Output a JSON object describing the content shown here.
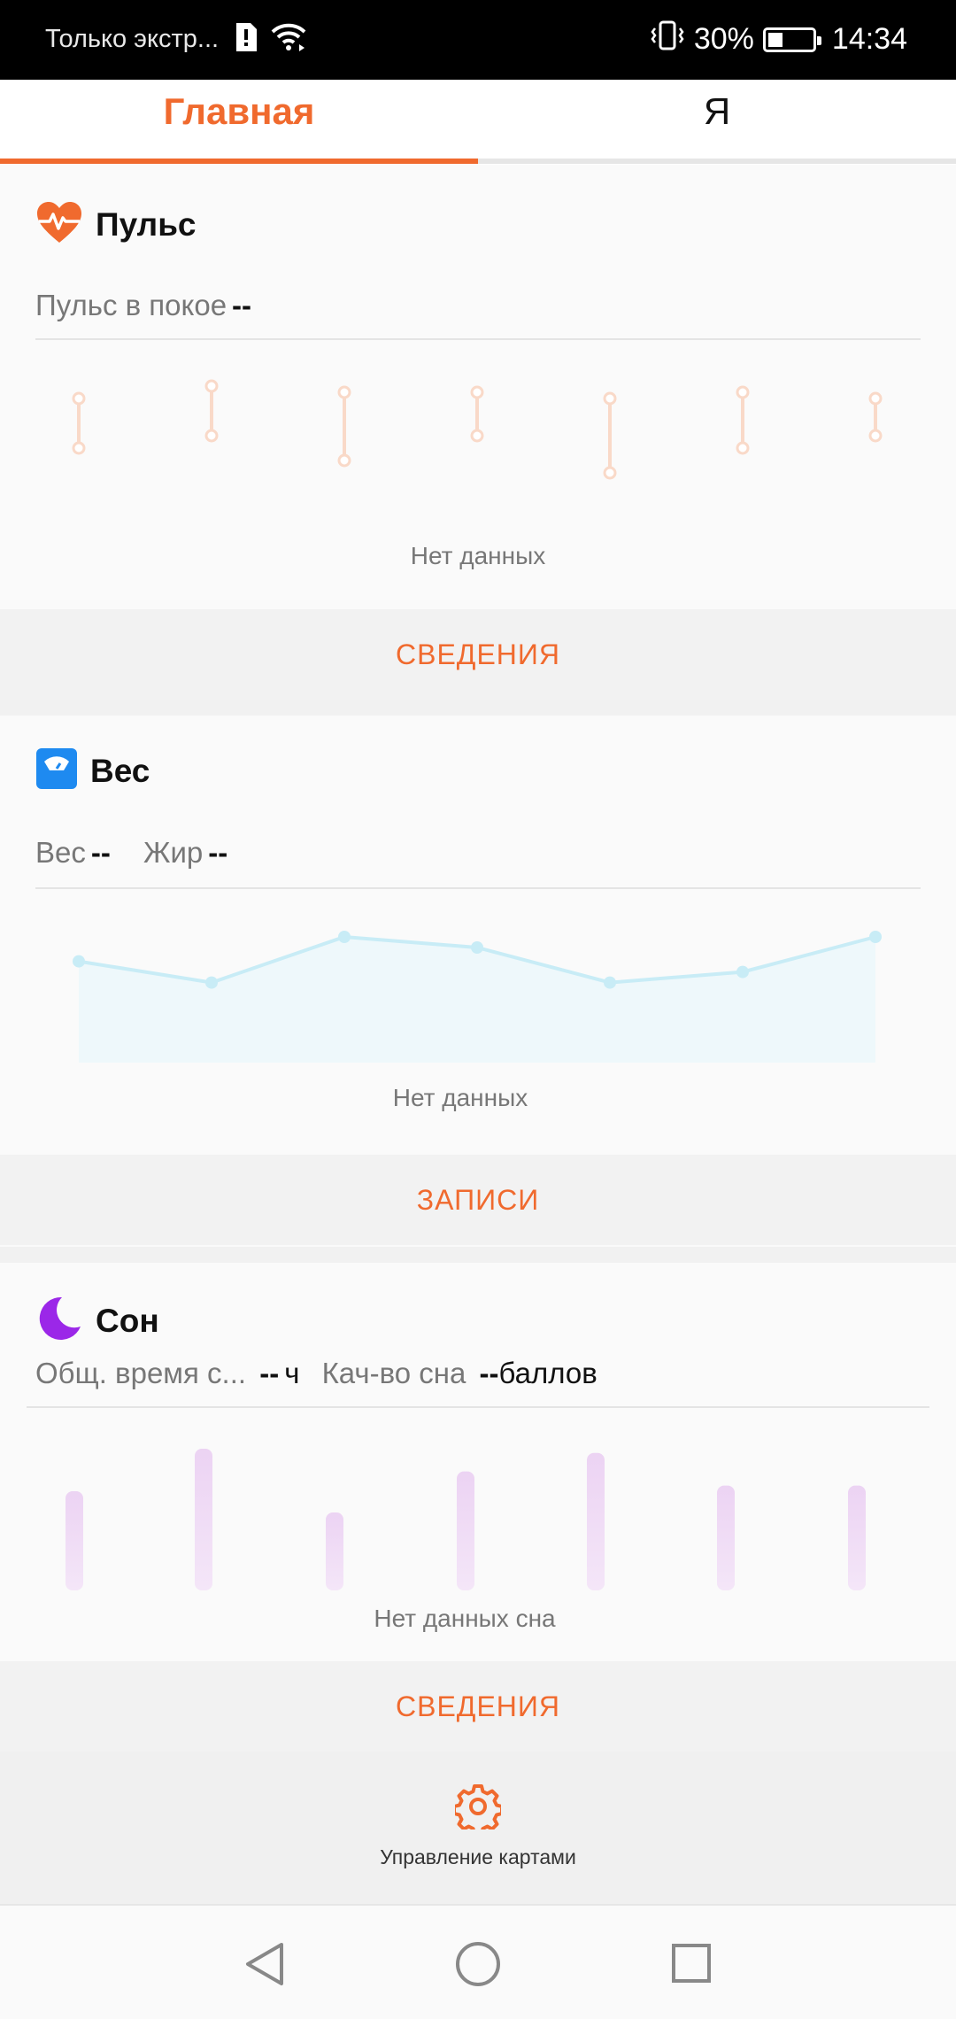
{
  "status_bar": {
    "carrier": "Только экстр...",
    "battery_text": "30%",
    "battery_level": 0.3,
    "time": "14:34"
  },
  "tabs": [
    {
      "label": "Главная",
      "active": true
    },
    {
      "label": "Я",
      "active": false
    }
  ],
  "pulse_card": {
    "title": "Пульс",
    "resting_label": "Пульс в покое",
    "resting_value": "--",
    "no_data": "Нет данных",
    "action": "СВЕДЕНИЯ"
  },
  "weight_card": {
    "title": "Вес",
    "weight_label": "Вес",
    "weight_value": "--",
    "fat_label": "Жир",
    "fat_value": "--",
    "no_data": "Нет данных",
    "action": "ЗАПИСИ"
  },
  "sleep_card": {
    "title": "Сон",
    "total_label": "Общ. время с...",
    "total_value": "--",
    "total_unit": "ч",
    "quality_label": "Кач-во сна",
    "quality_value": "--",
    "quality_unit": "баллов",
    "no_data": "Нет данных сна",
    "action": "СВЕДЕНИЯ"
  },
  "manage_cards": {
    "label": "Управление картами",
    "icon": "gear-icon"
  },
  "navigation": {
    "back_icon": "back-triangle-icon",
    "home_icon": "home-circle-icon",
    "recents_icon": "recents-square-icon"
  },
  "colors": {
    "accent": "#f06a2e",
    "pulse_placeholder": "#f9d9c8",
    "weight_placeholder": "#c8ecf6",
    "sleep_placeholder": "#ecd3f3",
    "sleep_icon": "#9b27e8",
    "weight_icon": "#1e8af0"
  },
  "chart_data": [
    {
      "type": "bar",
      "name": "pulse-placeholder",
      "categories": [
        "1",
        "2",
        "3",
        "4",
        "5",
        "6",
        "7"
      ],
      "ranges": [
        [
          0.5,
          0.9
        ],
        [
          0.6,
          1.0
        ],
        [
          0.4,
          0.95
        ],
        [
          0.6,
          0.95
        ],
        [
          0.3,
          0.9
        ],
        [
          0.5,
          0.95
        ],
        [
          0.6,
          0.9
        ]
      ]
    },
    {
      "type": "line",
      "name": "weight-placeholder",
      "x": [
        1,
        2,
        3,
        4,
        5,
        6,
        7
      ],
      "y": [
        0.62,
        0.42,
        0.85,
        0.75,
        0.42,
        0.52,
        0.85
      ]
    },
    {
      "type": "bar",
      "name": "sleep-placeholder",
      "categories": [
        "1",
        "2",
        "3",
        "4",
        "5",
        "6",
        "7"
      ],
      "values": [
        0.7,
        1.0,
        0.55,
        0.84,
        0.97,
        0.74,
        0.74
      ]
    }
  ]
}
